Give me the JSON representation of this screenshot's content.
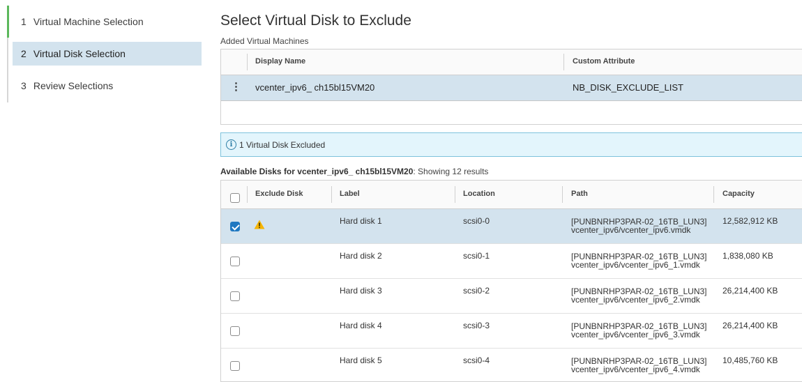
{
  "sidebar": {
    "steps": [
      {
        "num": "1",
        "label": "Virtual Machine Selection"
      },
      {
        "num": "2",
        "label": "Virtual Disk Selection"
      },
      {
        "num": "3",
        "label": "Review Selections"
      }
    ],
    "active_step_color": "#5cb85c"
  },
  "page": {
    "title": "Select Virtual Disk to Exclude",
    "added_vms_label": "Added Virtual Machines"
  },
  "vm_table": {
    "columns": [
      "Display Name",
      "Custom Attribute"
    ],
    "rows": [
      {
        "display_name": "vcenter_ipv6_ ch15bl15VM20",
        "custom_attribute": "NB_DISK_EXCLUDE_LIST"
      }
    ]
  },
  "banner": {
    "icon": "info-icon",
    "message": "1 Virtual Disk Excluded"
  },
  "available": {
    "prefix": "Available Disks for vcenter_ipv6_ ch15bl15VM20",
    "suffix": ": Showing 12 results"
  },
  "disk_table": {
    "columns": [
      "Exclude Disk",
      "Label",
      "Location",
      "Path",
      "Capacity"
    ],
    "rows": [
      {
        "checked": true,
        "warning": true,
        "label": "Hard disk 1",
        "location": "scsi0-0",
        "path_line1": "[PUNBNRHP3PAR-02_16TB_LUN3]",
        "path_line2": "vcenter_ipv6/vcenter_ipv6.vmdk",
        "capacity": "12,582,912 KB"
      },
      {
        "checked": false,
        "warning": false,
        "label": "Hard disk 2",
        "location": "scsi0-1",
        "path_line1": "[PUNBNRHP3PAR-02_16TB_LUN3]",
        "path_line2": "vcenter_ipv6/vcenter_ipv6_1.vmdk",
        "capacity": "1,838,080 KB"
      },
      {
        "checked": false,
        "warning": false,
        "label": "Hard disk 3",
        "location": "scsi0-2",
        "path_line1": "[PUNBNRHP3PAR-02_16TB_LUN3]",
        "path_line2": "vcenter_ipv6/vcenter_ipv6_2.vmdk",
        "capacity": "26,214,400 KB"
      },
      {
        "checked": false,
        "warning": false,
        "label": "Hard disk 4",
        "location": "scsi0-3",
        "path_line1": "[PUNBNRHP3PAR-02_16TB_LUN3]",
        "path_line2": "vcenter_ipv6/vcenter_ipv6_3.vmdk",
        "capacity": "26,214,400 KB"
      },
      {
        "checked": false,
        "warning": false,
        "label": "Hard disk 5",
        "location": "scsi0-4",
        "path_line1": "[PUNBNRHP3PAR-02_16TB_LUN3]",
        "path_line2": "vcenter_ipv6/vcenter_ipv6_4.vmdk",
        "capacity": "10,485,760 KB"
      }
    ]
  }
}
